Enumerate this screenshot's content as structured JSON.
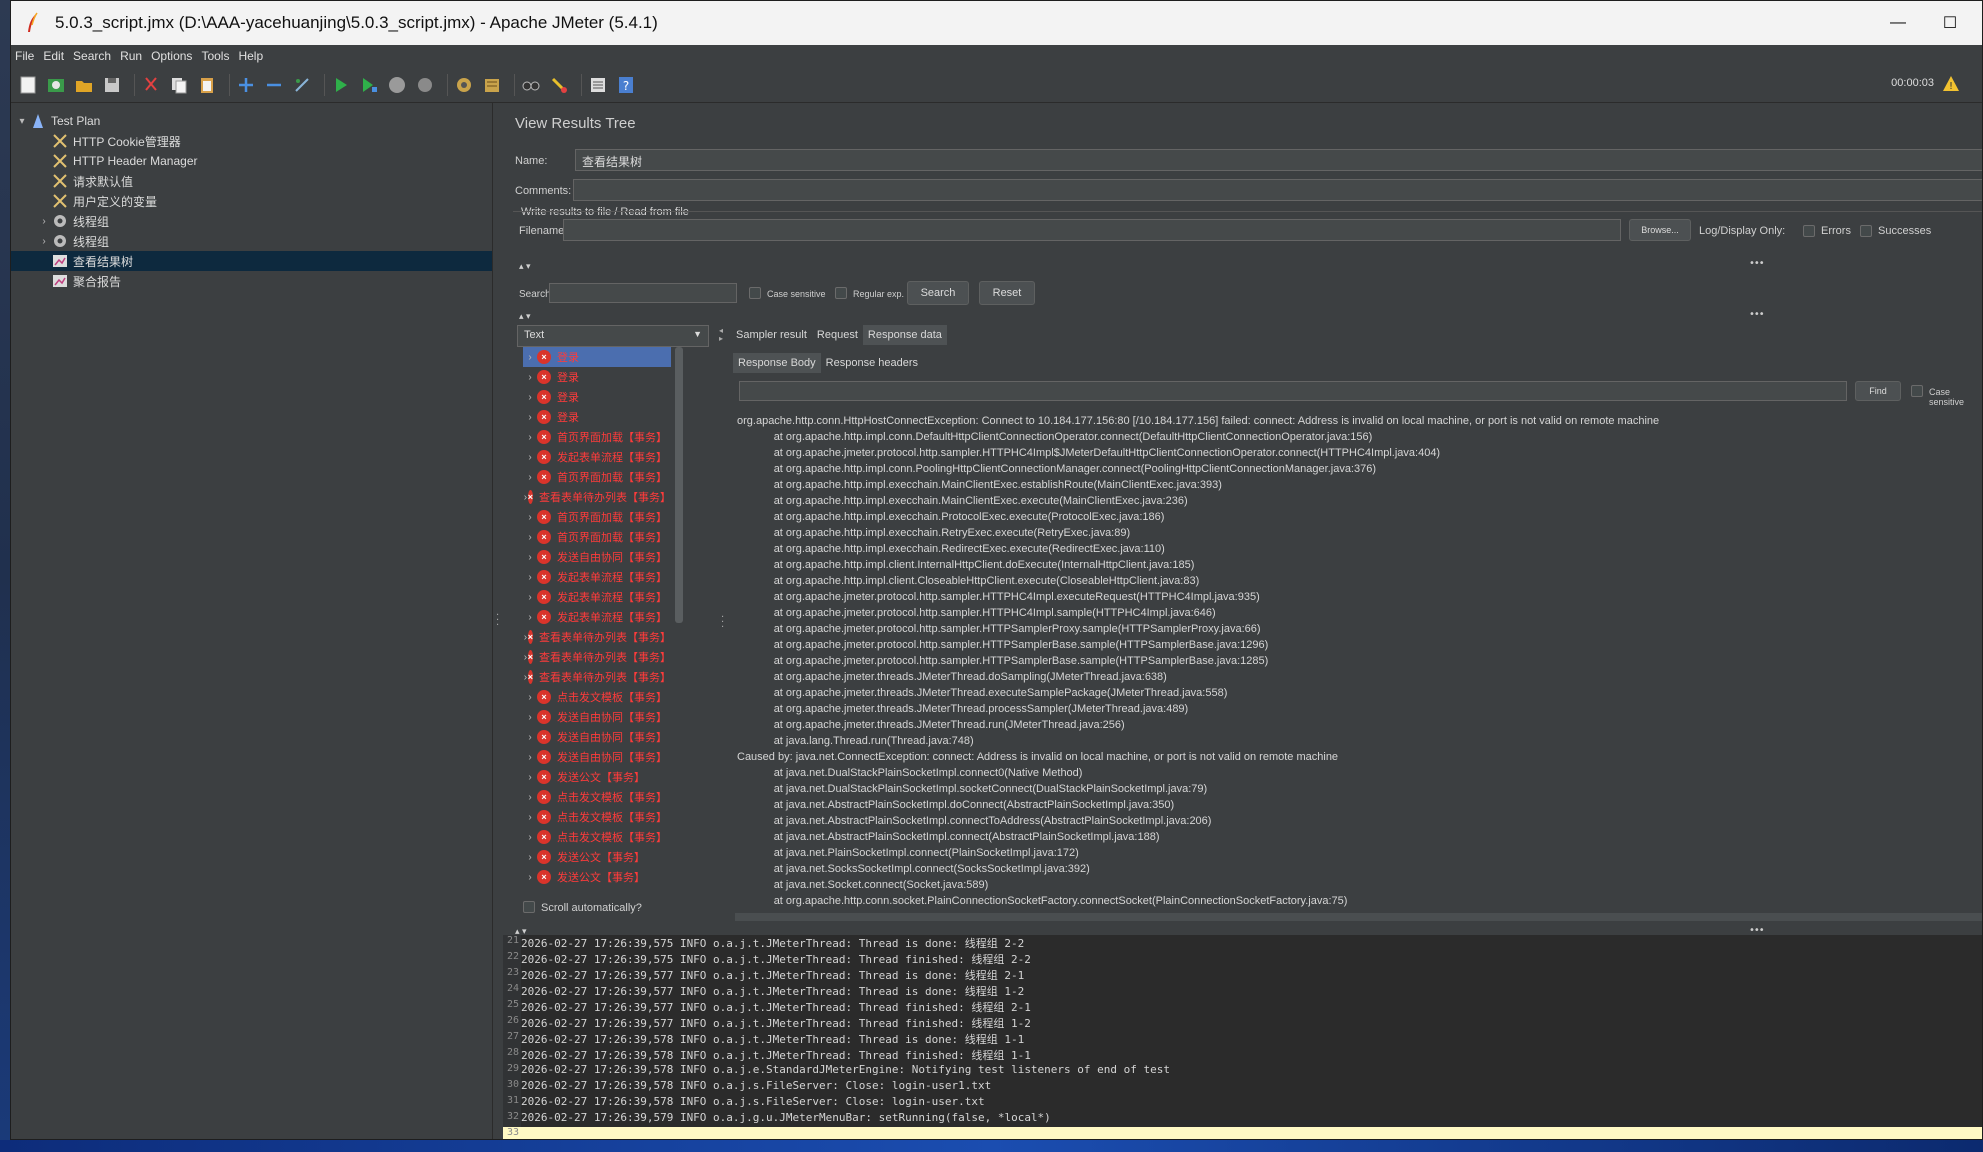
{
  "window": {
    "title": "5.0.3_script.jmx (D:\\AAA-yacehuanjing\\5.0.3_script.jmx) - Apache JMeter (5.4.1)",
    "minimize": "—",
    "maximize": "☐"
  },
  "menu": [
    "File",
    "Edit",
    "Search",
    "Run",
    "Options",
    "Tools",
    "Help"
  ],
  "toolbar": {
    "timer": "00:00:03",
    "icons": [
      "new-icon",
      "templates-icon",
      "open-icon",
      "save-icon",
      "cut-icon",
      "copy-icon",
      "paste-icon",
      "expand-icon",
      "collapse-icon",
      "toggle-icon",
      "start-icon",
      "start-no-pause-icon",
      "stop-icon",
      "shutdown-icon",
      "clear-icon",
      "clear-all-icon",
      "search-icon",
      "reset-search-icon",
      "function-helper-icon",
      "help-icon"
    ]
  },
  "tree": [
    {
      "label": "Test Plan",
      "level": 0,
      "arrow": "▾",
      "icon": "test-plan-icon"
    },
    {
      "label": "HTTP Cookie管理器",
      "level": 1,
      "arrow": "",
      "icon": "config-element-icon"
    },
    {
      "label": "HTTP Header Manager",
      "level": 1,
      "arrow": "",
      "icon": "config-element-icon"
    },
    {
      "label": "请求默认值",
      "level": 1,
      "arrow": "",
      "icon": "config-element-icon"
    },
    {
      "label": "用户定义的变量",
      "level": 1,
      "arrow": "",
      "icon": "config-element-icon"
    },
    {
      "label": "线程组",
      "level": 1,
      "arrow": "›",
      "icon": "thread-group-icon"
    },
    {
      "label": "线程组",
      "level": 1,
      "arrow": "›",
      "icon": "thread-group-icon"
    },
    {
      "label": "查看结果树",
      "level": 1,
      "arrow": "",
      "icon": "listener-icon",
      "selected": true
    },
    {
      "label": "聚合报告",
      "level": 1,
      "arrow": "",
      "icon": "listener-icon"
    }
  ],
  "panel": {
    "title": "View Results Tree",
    "name_label": "Name:",
    "name_value": "查看结果树",
    "comments_label": "Comments:",
    "write_results": "Write results to file / Read from file",
    "filename_label": "Filename",
    "browse": "Browse...",
    "log_display": "Log/Display Only:",
    "errors": "Errors",
    "successes": "Successes",
    "search_label": "Search:",
    "case_sensitive": "Case sensitive",
    "regular_exp": "Regular exp.",
    "search_btn": "Search",
    "reset_btn": "Reset",
    "renderer": "Text",
    "scroll_auto": "Scroll automatically?",
    "find_btn": "Find",
    "case_sensitive2": "Case sensitive"
  },
  "result_tabs": [
    "Sampler result",
    "Request",
    "Response data"
  ],
  "response_tabs": [
    "Response Body",
    "Response headers"
  ],
  "results": [
    "登录",
    "登录",
    "登录",
    "登录",
    "首页界面加载【事务】",
    "发起表单流程【事务】",
    "首页界面加载【事务】",
    "查看表单待办列表【事务】",
    "首页界面加载【事务】",
    "首页界面加载【事务】",
    "发送自由协同【事务】",
    "发起表单流程【事务】",
    "发起表单流程【事务】",
    "发起表单流程【事务】",
    "查看表单待办列表【事务】",
    "查看表单待办列表【事务】",
    "查看表单待办列表【事务】",
    "点击发文模板【事务】",
    "发送自由协同【事务】",
    "发送自由协同【事务】",
    "发送自由协同【事务】",
    "发送公文【事务】",
    "点击发文模板【事务】",
    "点击发文模板【事务】",
    "点击发文模板【事务】",
    "发送公文【事务】",
    "发送公文【事务】"
  ],
  "response_body": [
    "org.apache.http.conn.HttpHostConnectException: Connect to 10.184.177.156:80 [/10.184.177.156] failed: connect: Address is invalid on local machine, or port is not valid on remote machine",
    "\t\t\tat org.apache.http.impl.conn.DefaultHttpClientConnectionOperator.connect(DefaultHttpClientConnectionOperator.java:156)",
    "\t\t\tat org.apache.jmeter.protocol.http.sampler.HTTPHC4Impl$JMeterDefaultHttpClientConnectionOperator.connect(HTTPHC4Impl.java:404)",
    "\t\t\tat org.apache.http.impl.conn.PoolingHttpClientConnectionManager.connect(PoolingHttpClientConnectionManager.java:376)",
    "\t\t\tat org.apache.http.impl.execchain.MainClientExec.establishRoute(MainClientExec.java:393)",
    "\t\t\tat org.apache.http.impl.execchain.MainClientExec.execute(MainClientExec.java:236)",
    "\t\t\tat org.apache.http.impl.execchain.ProtocolExec.execute(ProtocolExec.java:186)",
    "\t\t\tat org.apache.http.impl.execchain.RetryExec.execute(RetryExec.java:89)",
    "\t\t\tat org.apache.http.impl.execchain.RedirectExec.execute(RedirectExec.java:110)",
    "\t\t\tat org.apache.http.impl.client.InternalHttpClient.doExecute(InternalHttpClient.java:185)",
    "\t\t\tat org.apache.http.impl.client.CloseableHttpClient.execute(CloseableHttpClient.java:83)",
    "\t\t\tat org.apache.jmeter.protocol.http.sampler.HTTPHC4Impl.executeRequest(HTTPHC4Impl.java:935)",
    "\t\t\tat org.apache.jmeter.protocol.http.sampler.HTTPHC4Impl.sample(HTTPHC4Impl.java:646)",
    "\t\t\tat org.apache.jmeter.protocol.http.sampler.HTTPSamplerProxy.sample(HTTPSamplerProxy.java:66)",
    "\t\t\tat org.apache.jmeter.protocol.http.sampler.HTTPSamplerBase.sample(HTTPSamplerBase.java:1296)",
    "\t\t\tat org.apache.jmeter.protocol.http.sampler.HTTPSamplerBase.sample(HTTPSamplerBase.java:1285)",
    "\t\t\tat org.apache.jmeter.threads.JMeterThread.doSampling(JMeterThread.java:638)",
    "\t\t\tat org.apache.jmeter.threads.JMeterThread.executeSamplePackage(JMeterThread.java:558)",
    "\t\t\tat org.apache.jmeter.threads.JMeterThread.processSampler(JMeterThread.java:489)",
    "\t\t\tat org.apache.jmeter.threads.JMeterThread.run(JMeterThread.java:256)",
    "\t\t\tat java.lang.Thread.run(Thread.java:748)",
    "Caused by: java.net.ConnectException: connect: Address is invalid on local machine, or port is not valid on remote machine",
    "\t\t\tat java.net.DualStackPlainSocketImpl.connect0(Native Method)",
    "\t\t\tat java.net.DualStackPlainSocketImpl.socketConnect(DualStackPlainSocketImpl.java:79)",
    "\t\t\tat java.net.AbstractPlainSocketImpl.doConnect(AbstractPlainSocketImpl.java:350)",
    "\t\t\tat java.net.AbstractPlainSocketImpl.connectToAddress(AbstractPlainSocketImpl.java:206)",
    "\t\t\tat java.net.AbstractPlainSocketImpl.connect(AbstractPlainSocketImpl.java:188)",
    "\t\t\tat java.net.PlainSocketImpl.connect(PlainSocketImpl.java:172)",
    "\t\t\tat java.net.SocksSocketImpl.connect(SocksSocketImpl.java:392)",
    "\t\t\tat java.net.Socket.connect(Socket.java:589)",
    "\t\t\tat org.apache.http.conn.socket.PlainConnectionSocketFactory.connectSocket(PlainConnectionSocketFactory.java:75)"
  ],
  "log": [
    {
      "n": "21",
      "text": "2026-02-27 17:26:39,575 INFO o.a.j.t.JMeterThread: Thread is done: 线程组 2-2"
    },
    {
      "n": "22",
      "text": "2026-02-27 17:26:39,575 INFO o.a.j.t.JMeterThread: Thread finished: 线程组 2-2"
    },
    {
      "n": "23",
      "text": "2026-02-27 17:26:39,577 INFO o.a.j.t.JMeterThread: Thread is done: 线程组 2-1"
    },
    {
      "n": "24",
      "text": "2026-02-27 17:26:39,577 INFO o.a.j.t.JMeterThread: Thread is done: 线程组 1-2"
    },
    {
      "n": "25",
      "text": "2026-02-27 17:26:39,577 INFO o.a.j.t.JMeterThread: Thread finished: 线程组 2-1"
    },
    {
      "n": "26",
      "text": "2026-02-27 17:26:39,577 INFO o.a.j.t.JMeterThread: Thread finished: 线程组 1-2"
    },
    {
      "n": "27",
      "text": "2026-02-27 17:26:39,578 INFO o.a.j.t.JMeterThread: Thread is done: 线程组 1-1"
    },
    {
      "n": "28",
      "text": "2026-02-27 17:26:39,578 INFO o.a.j.t.JMeterThread: Thread finished: 线程组 1-1"
    },
    {
      "n": "29",
      "text": "2026-02-27 17:26:39,578 INFO o.a.j.e.StandardJMeterEngine: Notifying test listeners of end of test"
    },
    {
      "n": "30",
      "text": "2026-02-27 17:26:39,578 INFO o.a.j.s.FileServer: Close: login-user1.txt"
    },
    {
      "n": "31",
      "text": "2026-02-27 17:26:39,578 INFO o.a.j.s.FileServer: Close: login-user.txt"
    },
    {
      "n": "32",
      "text": "2026-02-27 17:26:39,579 INFO o.a.j.g.u.JMeterMenuBar: setRunning(false, *local*)"
    },
    {
      "n": "33",
      "text": ""
    }
  ],
  "colors": {
    "error_red": "#ff3b3b",
    "selected_row": "#4b6eaf",
    "tree_selected": "#0d293e",
    "log_current": "#fff9c4"
  }
}
